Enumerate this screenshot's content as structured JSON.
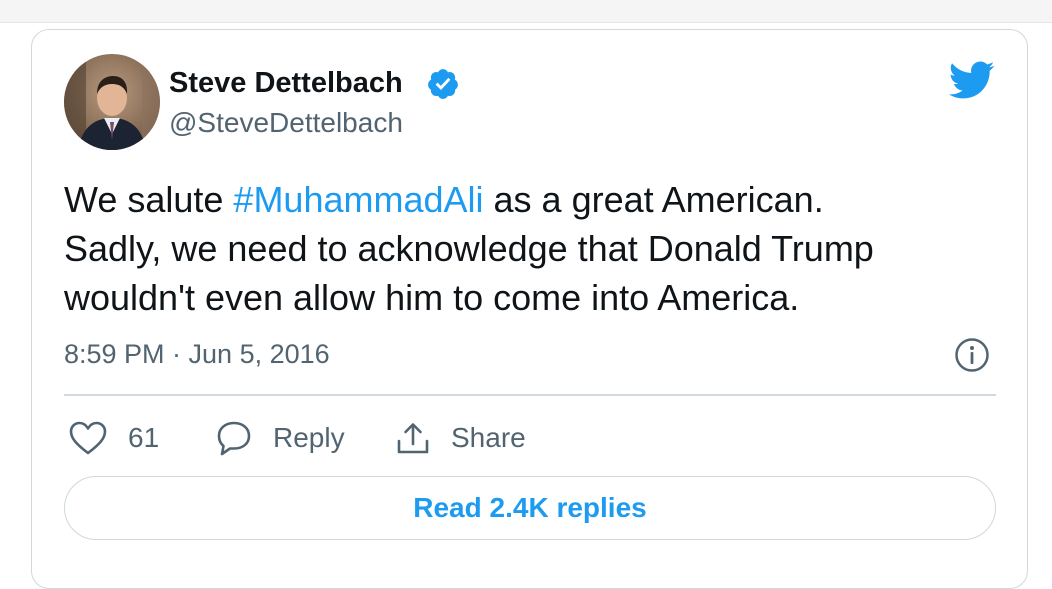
{
  "tweet": {
    "author": {
      "display_name": "Steve Dettelbach",
      "handle": "@SteveDettelbach",
      "verified": true
    },
    "text_lines": [
      {
        "before": "We salute ",
        "hashtag": "#MuhammadAli",
        "after": " as a great American."
      },
      {
        "text": "Sadly, we need to acknowledge that Donald Trump"
      },
      {
        "text": "wouldn't even allow him to come into America."
      }
    ],
    "timestamp": "8:59 PM · Jun 5, 2016",
    "actions": {
      "like_count": "61",
      "reply_label": "Reply",
      "share_label": "Share"
    },
    "read_replies_label": "Read 2.4K replies"
  },
  "colors": {
    "accent": "#1d9bf0",
    "text": "#0f1419",
    "secondary": "#536471",
    "border": "#cfd9de"
  },
  "icons": [
    "verified-badge-icon",
    "twitter-bird-icon",
    "info-icon",
    "heart-icon",
    "reply-bubble-icon",
    "share-icon"
  ]
}
